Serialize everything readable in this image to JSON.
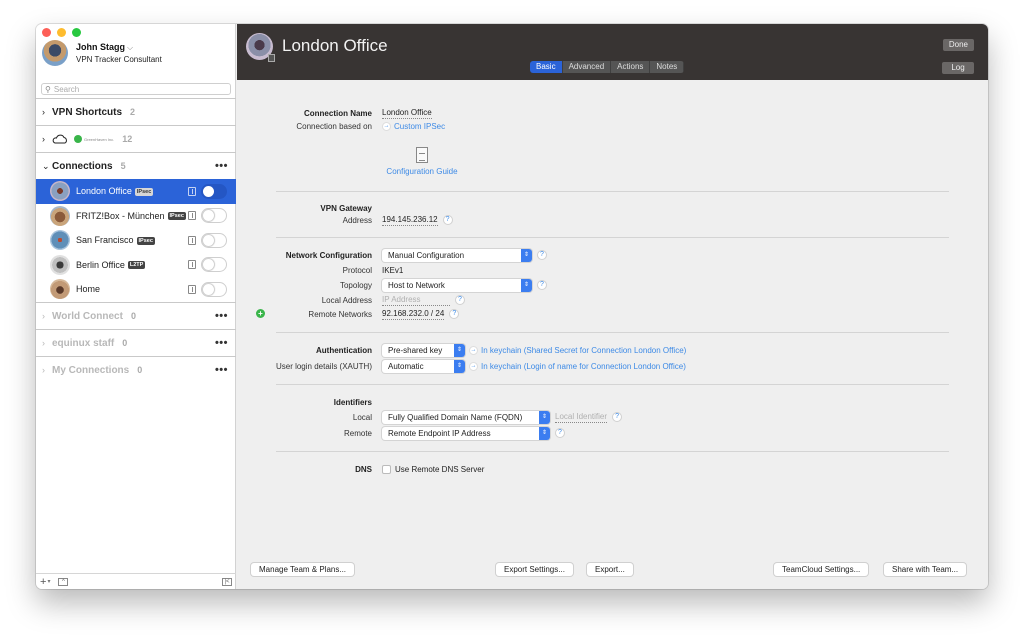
{
  "window_controls": [
    "close",
    "minimize",
    "maximize"
  ],
  "user": {
    "name": "John Stagg",
    "role": "VPN Tracker Consultant"
  },
  "search": {
    "placeholder": "Search",
    "value": ""
  },
  "sidebar": {
    "groups": [
      {
        "label": "VPN Shortcuts",
        "count": "2",
        "expanded": false
      },
      {
        "label": "GreenHaven Inc.",
        "count": "12",
        "expanded": false,
        "icon": "cloud-icon"
      },
      {
        "label": "Connections",
        "count": "5",
        "expanded": true
      }
    ],
    "connections": [
      {
        "name": "London Office",
        "badge": "IPsec",
        "selected": true,
        "on": false
      },
      {
        "name": "FRITZ!Box - München",
        "badge": "IPsec",
        "selected": false,
        "on": false
      },
      {
        "name": "San Francisco",
        "badge": "IPsec",
        "selected": false,
        "on": false
      },
      {
        "name": "Berlin Office",
        "badge": "L2TP",
        "selected": false,
        "on": false
      },
      {
        "name": "Home",
        "badge": "",
        "selected": false,
        "on": false
      }
    ],
    "other_groups": [
      {
        "label": "World Connect",
        "count": "0"
      },
      {
        "label": "equinux staff",
        "count": "0"
      },
      {
        "label": "My Connections",
        "count": "0"
      }
    ],
    "more_glyph": "•••",
    "footer": {
      "add": "+",
      "add_caret": "▾",
      "box": "^",
      "collapse": "|<"
    }
  },
  "header": {
    "title": "London Office",
    "tabs": [
      "Basic",
      "Advanced",
      "Actions",
      "Notes"
    ],
    "active_tab": "Basic",
    "done_label": "Done",
    "log_label": "Log"
  },
  "form": {
    "connection_name_label": "Connection Name",
    "connection_name": "London Office",
    "based_on_label": "Connection based on",
    "based_on": "Custom IPSec",
    "guide_label": "Configuration Guide",
    "gateway_label": "VPN Gateway",
    "address_label": "Address",
    "address": "194.145.236.12",
    "netconf_label": "Network Configuration",
    "netconf": "Manual Configuration",
    "protocol_label": "Protocol",
    "protocol": "IKEv1",
    "topology_label": "Topology",
    "topology": "Host to Network",
    "local_address_label": "Local Address",
    "local_address_placeholder": "IP Address",
    "remote_networks_label": "Remote Networks",
    "remote_networks": "92.168.232.0 / 24",
    "auth_label": "Authentication",
    "auth": "Pre-shared key",
    "auth_keychain": "In keychain (Shared Secret for Connection London Office)",
    "xauth_label": "User login details (XAUTH)",
    "xauth": "Automatic",
    "xauth_keychain": "In keychain (Login of name for Connection London Office)",
    "identifiers_label": "Identifiers",
    "local_label": "Local",
    "local_id_type": "Fully Qualified Domain Name (FQDN)",
    "local_id_placeholder": "Local Identifier",
    "remote_label": "Remote",
    "remote_id_type": "Remote Endpoint IP Address",
    "dns_label": "DNS",
    "dns_checkbox": "Use Remote DNS Server",
    "dns_checked": false
  },
  "footer_buttons": {
    "manage_team": "Manage Team & Plans...",
    "export_settings": "Export Settings...",
    "export": "Export...",
    "teamcloud": "TeamCloud Settings...",
    "share": "Share with Team..."
  },
  "colors": {
    "accent": "#2b63d8",
    "header_bg": "#383433",
    "link": "#3d8ae6",
    "add_green": "#3ab54a"
  }
}
